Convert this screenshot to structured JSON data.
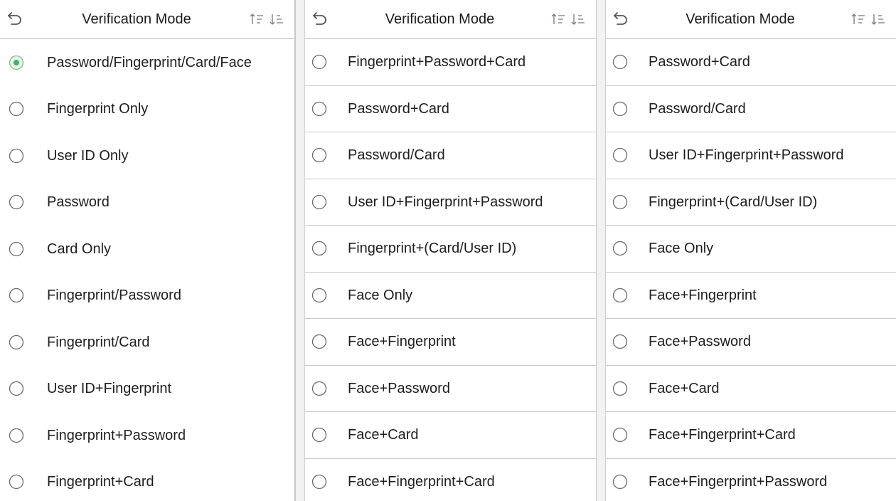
{
  "panels": [
    {
      "title": "Verification Mode",
      "items": [
        {
          "label": "Password/Fingerprint/Card/Face",
          "selected": true
        },
        {
          "label": "Fingerprint Only",
          "selected": false
        },
        {
          "label": "User ID Only",
          "selected": false
        },
        {
          "label": "Password",
          "selected": false
        },
        {
          "label": "Card Only",
          "selected": false
        },
        {
          "label": "Fingerprint/Password",
          "selected": false
        },
        {
          "label": "Fingerprint/Card",
          "selected": false
        },
        {
          "label": "User ID+Fingerprint",
          "selected": false
        },
        {
          "label": "Fingerprint+Password",
          "selected": false
        },
        {
          "label": "Fingerprint+Card",
          "selected": false
        }
      ]
    },
    {
      "title": "Verification Mode",
      "items": [
        {
          "label": "Fingerprint+Password+Card",
          "selected": false
        },
        {
          "label": "Password+Card",
          "selected": false
        },
        {
          "label": "Password/Card",
          "selected": false
        },
        {
          "label": "User ID+Fingerprint+Password",
          "selected": false
        },
        {
          "label": "Fingerprint+(Card/User ID)",
          "selected": false
        },
        {
          "label": "Face Only",
          "selected": false
        },
        {
          "label": "Face+Fingerprint",
          "selected": false
        },
        {
          "label": "Face+Password",
          "selected": false
        },
        {
          "label": "Face+Card",
          "selected": false
        },
        {
          "label": "Face+Fingerprint+Card",
          "selected": false
        }
      ]
    },
    {
      "title": "Verification Mode",
      "items": [
        {
          "label": "Password+Card",
          "selected": false
        },
        {
          "label": "Password/Card",
          "selected": false
        },
        {
          "label": "User ID+Fingerprint+Password",
          "selected": false
        },
        {
          "label": "Fingerprint+(Card/User ID)",
          "selected": false
        },
        {
          "label": "Face Only",
          "selected": false
        },
        {
          "label": "Face+Fingerprint",
          "selected": false
        },
        {
          "label": "Face+Password",
          "selected": false
        },
        {
          "label": "Face+Card",
          "selected": false
        },
        {
          "label": "Face+Fingerprint+Card",
          "selected": false
        },
        {
          "label": "Face+Fingerprint+Password",
          "selected": false
        }
      ]
    }
  ],
  "icons": {
    "back": "back-arrow-icon",
    "sort_ascending": "sort-ascending-icon",
    "sort_descending": "sort-descending-icon",
    "radio_selected": "radio-selected-icon",
    "radio_unselected": "radio-unselected-icon"
  },
  "colors": {
    "radio_selected_fill": "#4cae62",
    "radio_outline": "#6a6a6a",
    "icon": "#555555"
  }
}
